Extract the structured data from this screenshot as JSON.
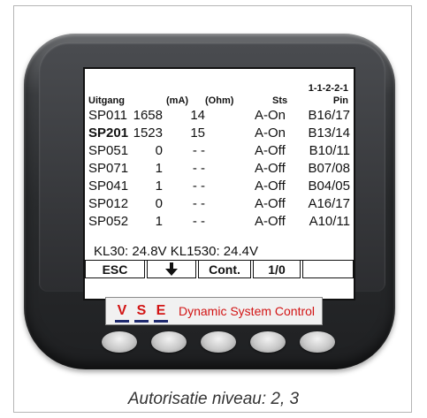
{
  "screen": {
    "header": {
      "col_name": "Uitgang",
      "col_ma": "(mA)",
      "col_ohm": "(Ohm)",
      "col_sts": "Sts",
      "col_pin_top": "1-1-2-2-1",
      "col_pin": "Pin"
    },
    "rows": [
      {
        "name": "SP011",
        "ma": "1658",
        "ohm": "14",
        "sts": "A-On",
        "pin": "B16/17"
      },
      {
        "name": "SP201",
        "ma": "1523",
        "ohm": "15",
        "sts": "A-On",
        "pin": "B13/14"
      },
      {
        "name": "SP051",
        "ma": "0",
        "ohm": "- -",
        "sts": "A-Off",
        "pin": "B10/11"
      },
      {
        "name": "SP071",
        "ma": "1",
        "ohm": "- -",
        "sts": "A-Off",
        "pin": "B07/08"
      },
      {
        "name": "SP041",
        "ma": "1",
        "ohm": "- -",
        "sts": "A-Off",
        "pin": "B04/05"
      },
      {
        "name": "SP012",
        "ma": "0",
        "ohm": "- -",
        "sts": "A-Off",
        "pin": "A16/17"
      },
      {
        "name": "SP052",
        "ma": "1",
        "ohm": "- -",
        "sts": "A-Off",
        "pin": "A10/11"
      }
    ],
    "voltage_line": "KL30:  24.8V  KL1530:  24.4V",
    "softkeys": {
      "esc": "ESC",
      "down_icon": "arrow-down-icon",
      "cont": "Cont.",
      "toggle": "1/0",
      "empty": ""
    }
  },
  "logo": {
    "letters": [
      "V",
      "S",
      "E"
    ],
    "text": "Dynamic System Control",
    "accent_color": "#d21414",
    "underline_color": "#1f2a6e"
  },
  "caption": "Autorisatie niveau: 2, 3"
}
